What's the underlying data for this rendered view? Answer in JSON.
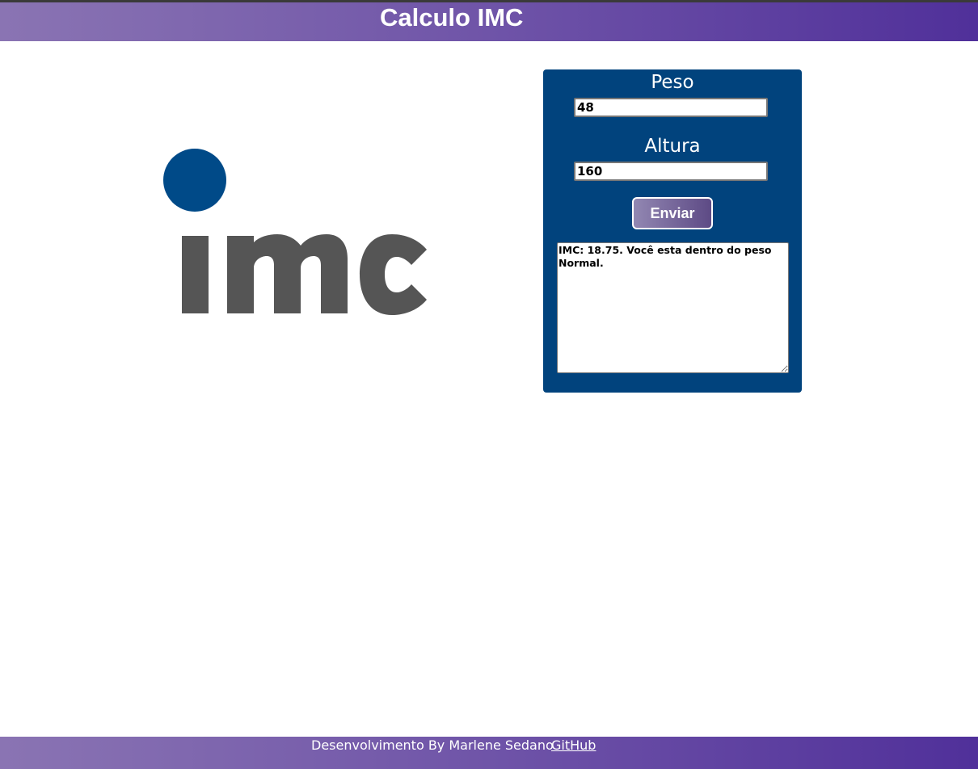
{
  "header": {
    "title": "Calculo IMC"
  },
  "logo": {
    "text": "imc",
    "dot_color": "#004a88",
    "text_color": "#555555"
  },
  "form": {
    "peso_label": "Peso",
    "peso_value": "48",
    "altura_label": "Altura",
    "altura_value": "160",
    "submit_label": "Enviar",
    "result_text": "IMC: 18.75. Você esta dentro do peso Normal.",
    "panel_color": "#01437d"
  },
  "footer": {
    "credit": "Desenvolvimento By Marlene Sedano",
    "link_label": "GitHub"
  },
  "colors": {
    "gradient_start": "#8a74b3",
    "gradient_end": "#50309a"
  }
}
